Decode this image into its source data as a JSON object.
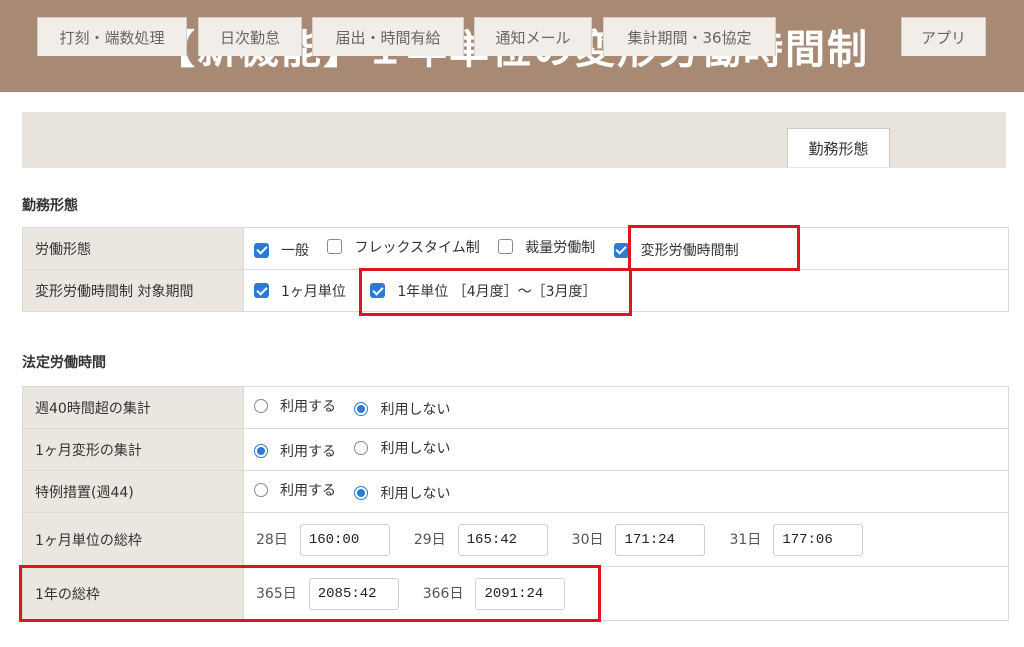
{
  "banner": {
    "title": "【新機能】１年単位の変形労働時間制"
  },
  "tabs": [
    {
      "label": "打刻・端数処理",
      "active": false
    },
    {
      "label": "日次勤怠",
      "active": false
    },
    {
      "label": "届出・時間有給",
      "active": false
    },
    {
      "label": "通知メール",
      "active": false
    },
    {
      "label": "集計期間・36協定",
      "active": false
    },
    {
      "label": "勤務形態",
      "active": true
    },
    {
      "label": "アプリ",
      "active": false
    }
  ],
  "work_style": {
    "section_title": "勤務形態",
    "labor_type": {
      "label": "労働形態",
      "options": [
        {
          "label": "一般",
          "checked": true
        },
        {
          "label": "フレックスタイム制",
          "checked": false
        },
        {
          "label": "裁量労働制",
          "checked": false
        },
        {
          "label": "変形労働時間制",
          "checked": true
        }
      ]
    },
    "target_period": {
      "label": "変形労働時間制 対象期間",
      "monthly": {
        "label": "1ヶ月単位",
        "checked": true
      },
      "yearly": {
        "label": "1年単位 ［4月度］〜［3月度］",
        "checked": true
      }
    }
  },
  "statutory": {
    "section_title": "法定労働時間",
    "rows": [
      {
        "label": "週40時間超の集計",
        "use": "利用する",
        "nouse": "利用しない",
        "selected": "nouse"
      },
      {
        "label": "1ヶ月変形の集計",
        "use": "利用する",
        "nouse": "利用しない",
        "selected": "use"
      },
      {
        "label": "特例措置(週44)",
        "use": "利用する",
        "nouse": "利用しない",
        "selected": "nouse"
      }
    ],
    "monthly_frame": {
      "label": "1ヶ月単位の総枠",
      "fields": [
        {
          "days": "28日",
          "value": "160:00"
        },
        {
          "days": "29日",
          "value": "165:42"
        },
        {
          "days": "30日",
          "value": "171:24"
        },
        {
          "days": "31日",
          "value": "177:06"
        }
      ]
    },
    "yearly_frame": {
      "label": "1年の総枠",
      "fields": [
        {
          "days": "365日",
          "value": "2085:42"
        },
        {
          "days": "366日",
          "value": "2091:24"
        }
      ]
    }
  },
  "colors": {
    "banner": "#a88a74",
    "highlight": "#e0141e",
    "accent": "#2b7bd6",
    "label_bg": "#ece6e1"
  }
}
